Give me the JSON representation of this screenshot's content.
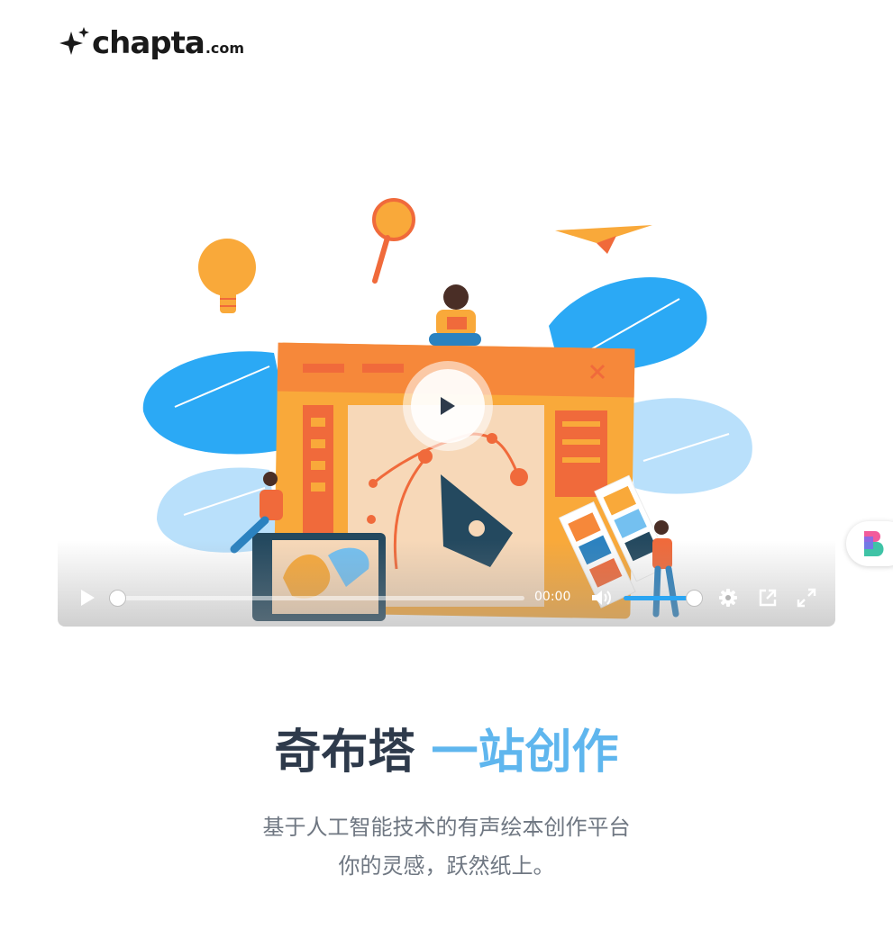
{
  "logo": {
    "name": "chapta",
    "suffix": ".com"
  },
  "video": {
    "current_time": "00:00",
    "progress": 0,
    "volume": 1.0,
    "controls": [
      "play-icon",
      "volume-icon",
      "gear-icon",
      "popout-icon",
      "fullscreen-icon"
    ]
  },
  "hero": {
    "title_main": "奇布塔",
    "title_accent": "一站创作",
    "subtitle_line1": "基于人工智能技术的有声绘本创作平台",
    "subtitle_line2": "你的灵感，跃然纸上。"
  },
  "colors": {
    "title_dark": "#2e3a4b",
    "title_accent": "#5fb6ee",
    "volume_fill": "#2ba5f2"
  }
}
